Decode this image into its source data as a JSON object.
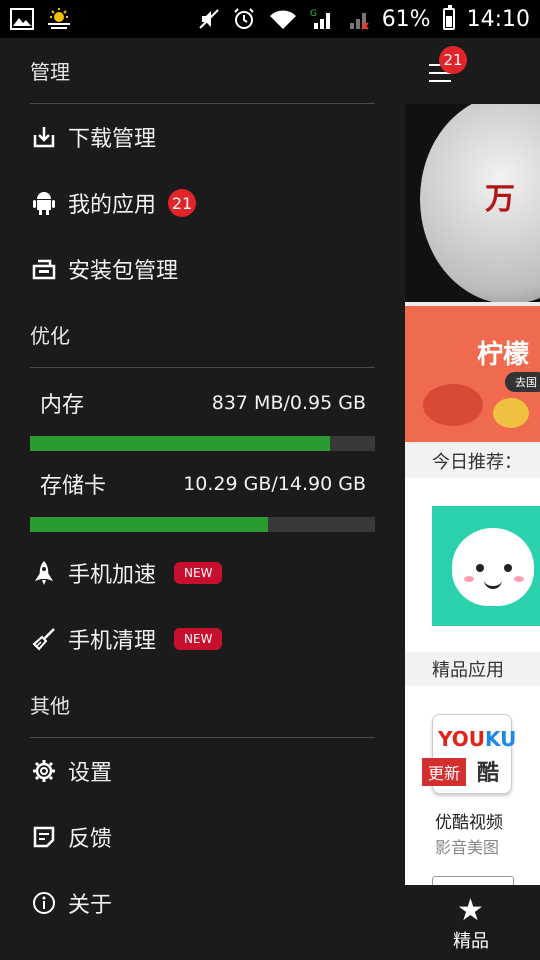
{
  "status_bar": {
    "battery": "61%",
    "time": "14:10",
    "icons": [
      "image-icon",
      "weather-icon",
      "mute-icon",
      "alarm-icon",
      "wifi-icon",
      "signal1-icon",
      "signal2-icon",
      "battery-icon"
    ],
    "signal_labels": [
      "G",
      "1",
      "2"
    ]
  },
  "drawer": {
    "section_manage": "管理",
    "items_manage": [
      {
        "label": "下载管理",
        "icon": "download-icon"
      },
      {
        "label": "我的应用",
        "icon": "android-icon",
        "badge": "21"
      },
      {
        "label": "安装包管理",
        "icon": "package-icon"
      }
    ],
    "section_optimize": "优化",
    "storage": [
      {
        "label": "内存",
        "value": "837 MB/0.95 GB",
        "fill": 0.87
      },
      {
        "label": "存储卡",
        "value": "10.29 GB/14.90 GB",
        "fill": 0.69
      }
    ],
    "items_optimize": [
      {
        "label": "手机加速",
        "icon": "rocket-icon",
        "badge": "NEW"
      },
      {
        "label": "手机清理",
        "icon": "broom-icon",
        "badge": "NEW"
      }
    ],
    "section_other": "其他",
    "items_other": [
      {
        "label": "设置",
        "icon": "gear-icon"
      },
      {
        "label": "反馈",
        "icon": "feedback-icon"
      },
      {
        "label": "关于",
        "icon": "info-icon"
      }
    ]
  },
  "peek": {
    "badge": "21",
    "banner1_text": "万",
    "banner2_title": "柠檬",
    "banner2_pill": "去国",
    "today_label": "今日推荐：",
    "fine_label": "精品应用",
    "app_name": "优酷视频",
    "app_category": "影音美图",
    "update_tag": "更新",
    "youku_word": "YOUKU",
    "youku_cn": "酷",
    "tab_label": "精品"
  },
  "colors": {
    "background": "#1b1b1b",
    "bar_fill": "#2a9b32",
    "bar_track": "#393939",
    "badge": "#e0242a"
  }
}
